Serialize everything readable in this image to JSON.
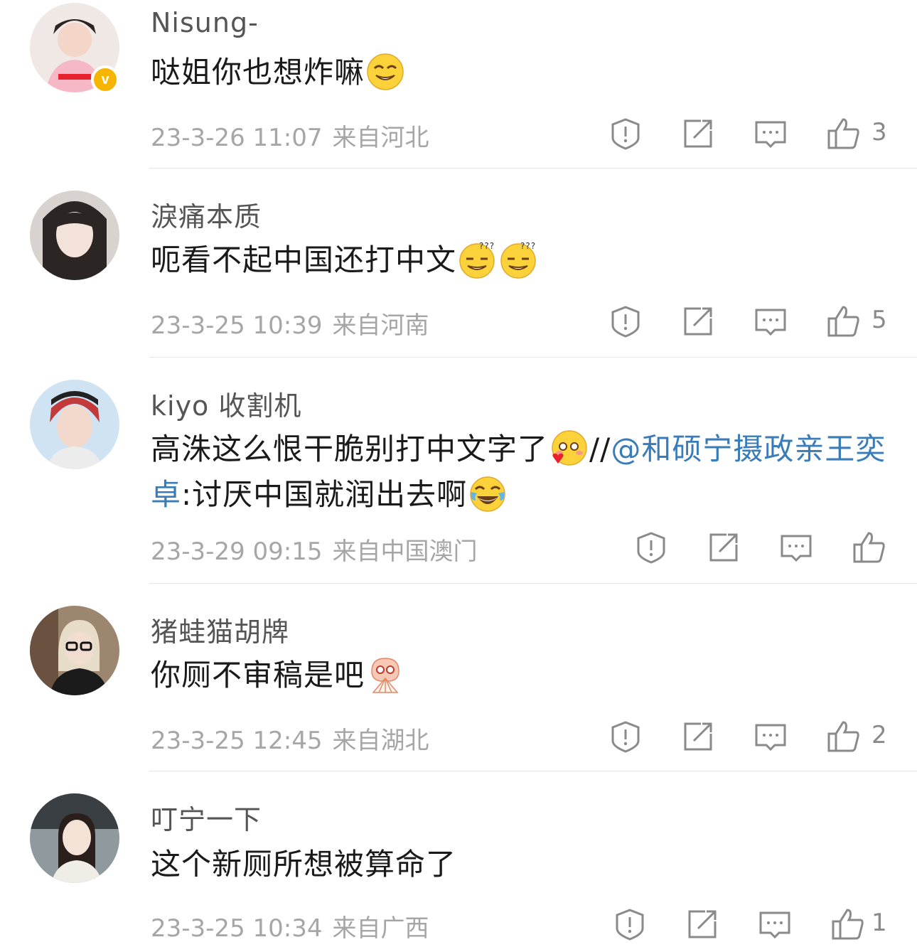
{
  "comments": [
    {
      "username": "Nisung-",
      "text": "哒姐你也想炸嘛",
      "date": "23-3-26 11:07",
      "location": "来自河北",
      "likes": "3",
      "verified": true
    },
    {
      "username": "淚痛本质",
      "text": "呃看不起中国还打中文",
      "date": "23-3-25 10:39",
      "location": "来自河南",
      "likes": "5"
    },
    {
      "username": "kiyo 收割机",
      "text_prefix": "高洙这么恨干脆别打中文字了",
      "text_sep": "//",
      "mention": "@和硕宁摄政亲王奕卓",
      "text_suffix": ":讨厌中国就润出去啊",
      "date": "23-3-29 09:15",
      "location": "来自中国澳门",
      "likes": ""
    },
    {
      "username": "猪蛙猫胡牌",
      "text": "你厕不审稿是吧",
      "date": "23-3-25 12:45",
      "location": "来自湖北",
      "likes": "2"
    },
    {
      "username": "叮宁一下",
      "text": "这个新厕所想被算命了",
      "date": "23-3-25 10:34",
      "location": "来自广西",
      "likes": "1"
    }
  ],
  "colors": {
    "mention": "#3a7cb8",
    "meta": "#a6a6a6",
    "verified_badge": "#f7b500"
  },
  "icons": [
    "report-icon",
    "repost-icon",
    "comment-icon",
    "like-icon"
  ]
}
